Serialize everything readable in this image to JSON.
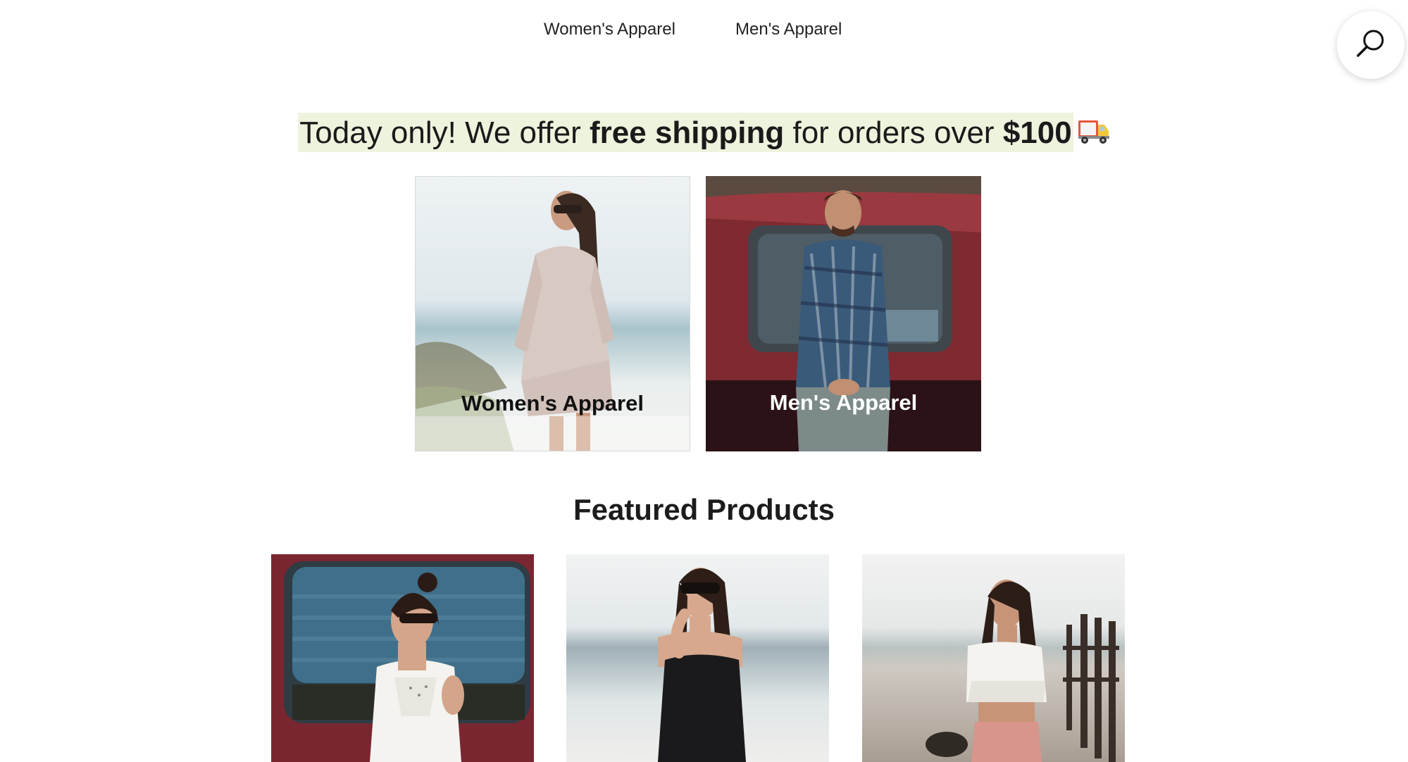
{
  "nav": {
    "women_label": "Women's Apparel",
    "men_label": "Men's Apparel",
    "search_icon": "search-icon"
  },
  "announcement": {
    "part1": "Today only! We offer ",
    "bold1": "free shipping",
    "part2": " for orders over ",
    "bold2": "$100",
    "emoji": "delivery-truck-icon",
    "highlight_color": "#eef3dd"
  },
  "categories": [
    {
      "label": "Women's Apparel",
      "image": "woman on beach in patterned dress"
    },
    {
      "label": "Men's Apparel",
      "image": "man in plaid shirt leaning on red van"
    }
  ],
  "featured": {
    "title": "Featured Products"
  }
}
